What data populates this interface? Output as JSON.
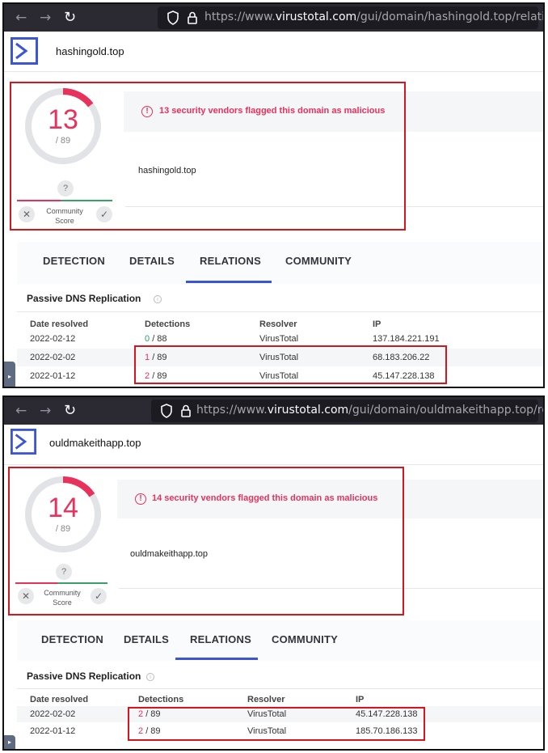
{
  "screens": [
    {
      "url_prefix": "https://www.",
      "url_host": "virustotal.com",
      "url_path": "/gui/domain/hashingold.top/relations",
      "domain": "hashingold.top",
      "score": "13",
      "total": "/ 89",
      "detection_ratio": 0.146,
      "alert": "13 security vendors flagged this domain as malicious",
      "community_question": "?",
      "community_label": "Community\nScore",
      "tabs": [
        "DETECTION",
        "DETAILS",
        "RELATIONS",
        "COMMUNITY"
      ],
      "active_tab": "RELATIONS",
      "section_title": "Passive DNS Replication",
      "columns": [
        "Date resolved",
        "Detections",
        "Resolver",
        "IP"
      ],
      "rows": [
        {
          "date": "2022-02-12",
          "det_num": "0",
          "det_total": "/ 88",
          "resolver": "VirusTotal",
          "ip": "137.184.221.191"
        },
        {
          "date": "2022-02-02",
          "det_num": "1",
          "det_total": "/ 89",
          "resolver": "VirusTotal",
          "ip": "68.183.206.22"
        },
        {
          "date": "2022-01-12",
          "det_num": "2",
          "det_total": "/ 89",
          "resolver": "VirusTotal",
          "ip": "45.147.228.138"
        }
      ]
    },
    {
      "url_prefix": "https://www.",
      "url_host": "virustotal.com",
      "url_path": "/gui/domain/ouldmakeithapp.top/relations",
      "domain": "ouldmakeithapp.top",
      "score": "14",
      "total": "/ 89",
      "detection_ratio": 0.157,
      "alert": "14 security vendors flagged this domain as malicious",
      "community_question": "?",
      "community_label": "Community\nScore",
      "tabs": [
        "DETECTION",
        "DETAILS",
        "RELATIONS",
        "COMMUNITY"
      ],
      "active_tab": "RELATIONS",
      "section_title": "Passive DNS Replication",
      "columns": [
        "Date resolved",
        "Detections",
        "Resolver",
        "IP"
      ],
      "rows": [
        {
          "date": "2022-02-02",
          "det_num": "2",
          "det_total": "/ 89",
          "resolver": "VirusTotal",
          "ip": "45.147.228.138"
        },
        {
          "date": "2022-01-12",
          "det_num": "2",
          "det_total": "/ 89",
          "resolver": "VirusTotal",
          "ip": "185.70.186.133"
        }
      ]
    }
  ],
  "icons": {
    "back": "arrow-left-icon",
    "forward": "arrow-right-icon",
    "reload": "reload-icon",
    "shield": "shield-icon",
    "lock": "lock-icon",
    "logo": "virustotal-logo",
    "alert": "alert-circle-icon",
    "info": "info-icon",
    "vote_down": "close-icon",
    "vote_up": "check-icon"
  },
  "colors": {
    "malicious": "#e8315b",
    "clean": "#2e9d5b",
    "brand_blue": "#3a55d6",
    "highlight_box": "#d8151c",
    "browser_bar": "#2b2a33"
  }
}
